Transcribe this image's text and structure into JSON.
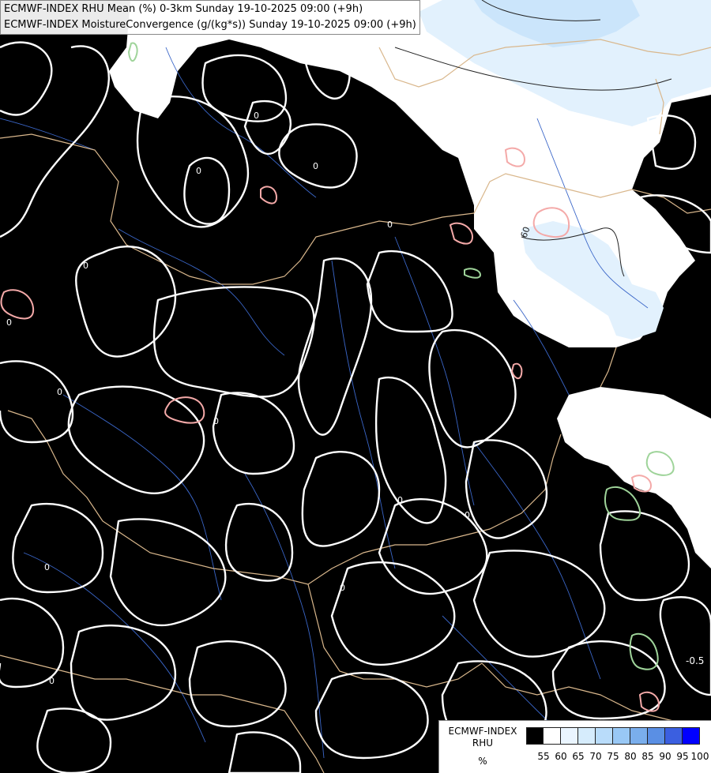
{
  "header": {
    "line1": "ECMWF-INDEX RHU Mean (%) 0-3km Sunday 19-10-2025 09:00 (+9h)",
    "line2": "ECMWF-INDEX MoistureConvergence (g/(kg*s)) Sunday 19-10-2025 09:00 (+9h)"
  },
  "legend": {
    "title_line1": "ECMWF-INDEX",
    "title_line2": "RHU",
    "unit": "%",
    "ticks": [
      "55",
      "60",
      "65",
      "70",
      "75",
      "80",
      "85",
      "90",
      "95",
      "100"
    ],
    "colors": [
      "#000000",
      "#ffffff",
      "#eaf5ff",
      "#d6ecfc",
      "#b9dcfa",
      "#99c8f5",
      "#7aaeec",
      "#5a8fe4",
      "#3b5fe0",
      "#0000ff"
    ]
  },
  "contour_labels": {
    "zero": "0",
    "sixty": "60",
    "minus_half": "-0.5"
  },
  "colors": {
    "background": "#000000",
    "humid": "#ffffff",
    "humid_light": "#e2f1fd",
    "humid_mid": "#cbe5fb",
    "convergence_zero": "#ffffff",
    "convergence_pos": "#f4a9a8",
    "convergence_neg": "#9fd49a",
    "border": "#d9b78c",
    "river": "#3a66c8"
  }
}
